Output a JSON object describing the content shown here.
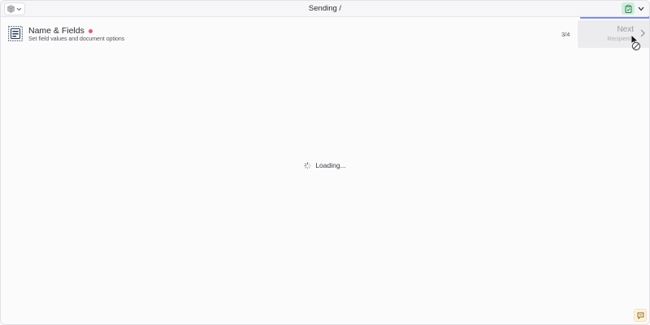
{
  "header": {
    "title": "Sending /",
    "app_switcher_icon": "cube-icon",
    "clipboard_icon": "clipboard-icon"
  },
  "step": {
    "title": "Name & Fields",
    "subtitle": "Set field values and document options",
    "counter": "3/4",
    "required_color": "#ea5a6c"
  },
  "next_button": {
    "label": "Next",
    "sublabel": "Recipients"
  },
  "loading": {
    "text": "Loading..."
  },
  "colors": {
    "accent": "#7d8df0",
    "clip_bg": "#cdeedb",
    "help_bg": "#fdf3dc"
  }
}
